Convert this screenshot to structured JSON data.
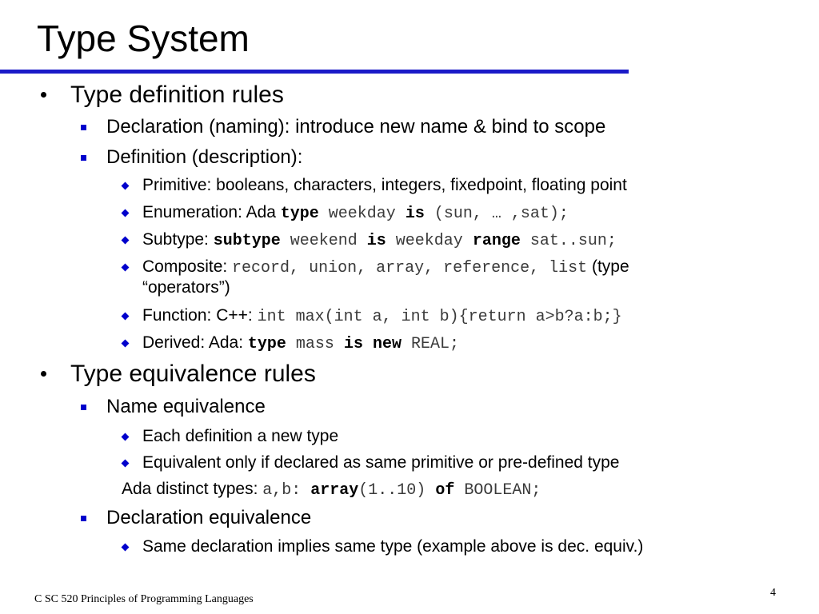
{
  "title": "Type System",
  "colors": {
    "rule": "#1a1ac8",
    "bullet_square": "#0000cc",
    "bullet_diamond": "#0000cc",
    "code": "#3a3a3a"
  },
  "bullet_icons": {
    "level1": "dot-bullet-icon",
    "level2": "square-bullet-icon",
    "level3": "diamond-bullet-icon"
  },
  "items": [
    {
      "level": 1,
      "segments": [
        {
          "t": "Type definition rules",
          "s": "text"
        }
      ]
    },
    {
      "level": 2,
      "segments": [
        {
          "t": "Declaration (naming):  introduce new name & bind to scope",
          "s": "text"
        }
      ]
    },
    {
      "level": 2,
      "segments": [
        {
          "t": "Definition (description):",
          "s": "text"
        }
      ]
    },
    {
      "level": 3,
      "segments": [
        {
          "t": "Primitive: booleans, characters, integers, fixedpoint, floating point",
          "s": "text"
        }
      ]
    },
    {
      "level": 3,
      "segments": [
        {
          "t": "Enumeration: Ada ",
          "s": "text"
        },
        {
          "t": "type",
          "s": "kw"
        },
        {
          "t": " weekday ",
          "s": "code"
        },
        {
          "t": "is",
          "s": "kw"
        },
        {
          "t": " (sun, … ,sat);",
          "s": "code"
        }
      ]
    },
    {
      "level": 3,
      "segments": [
        {
          "t": "Subtype: ",
          "s": "text"
        },
        {
          "t": "subtype",
          "s": "kw"
        },
        {
          "t": " weekend ",
          "s": "code"
        },
        {
          "t": "is",
          "s": "kw"
        },
        {
          "t": " weekday ",
          "s": "code"
        },
        {
          "t": "range",
          "s": "kw"
        },
        {
          "t": " sat..sun;",
          "s": "code"
        }
      ]
    },
    {
      "level": 3,
      "segments": [
        {
          "t": "Composite: ",
          "s": "text"
        },
        {
          "t": "record, union, array, reference, list",
          "s": "code"
        },
        {
          "t": " (type",
          "s": "text"
        }
      ]
    },
    {
      "level": 3,
      "continuation": true,
      "segments": [
        {
          "t": "“operators”)",
          "s": "text"
        }
      ]
    },
    {
      "level": 3,
      "segments": [
        {
          "t": "Function:  C++: ",
          "s": "text"
        },
        {
          "t": "int max(int a, int b){return a>b?a:b;}",
          "s": "code"
        }
      ]
    },
    {
      "level": 3,
      "segments": [
        {
          "t": "Derived: Ada: ",
          "s": "text"
        },
        {
          "t": "type",
          "s": "kw"
        },
        {
          "t": " mass ",
          "s": "code"
        },
        {
          "t": "is new",
          "s": "kw"
        },
        {
          "t": " REAL;",
          "s": "code"
        }
      ]
    },
    {
      "level": 1,
      "segments": [
        {
          "t": "Type equivalence rules",
          "s": "text"
        }
      ]
    },
    {
      "level": 2,
      "segments": [
        {
          "t": "Name equivalence",
          "s": "text"
        }
      ]
    },
    {
      "level": 3,
      "segments": [
        {
          "t": "Each definition a new type",
          "s": "text"
        }
      ]
    },
    {
      "level": 3,
      "segments": [
        {
          "t": "Equivalent only if declared as same primitive or pre-defined type",
          "s": "text"
        }
      ]
    },
    {
      "level": 0,
      "ada": true,
      "segments": [
        {
          "t": "Ada distinct types:  ",
          "s": "text"
        },
        {
          "t": "a,b:",
          "s": "code"
        },
        {
          "t": " array",
          "s": "kw"
        },
        {
          "t": "(1..10) ",
          "s": "code"
        },
        {
          "t": "of",
          "s": "kw"
        },
        {
          "t": " BOOLEAN;",
          "s": "code"
        }
      ]
    },
    {
      "level": 2,
      "segments": [
        {
          "t": "Declaration equivalence",
          "s": "text"
        }
      ]
    },
    {
      "level": 3,
      "segments": [
        {
          "t": "Same declaration implies same type (example above is dec. equiv.)",
          "s": "text"
        }
      ]
    }
  ],
  "footer": {
    "course": "C SC 520 Principles of Programming Languages",
    "page": "4"
  }
}
